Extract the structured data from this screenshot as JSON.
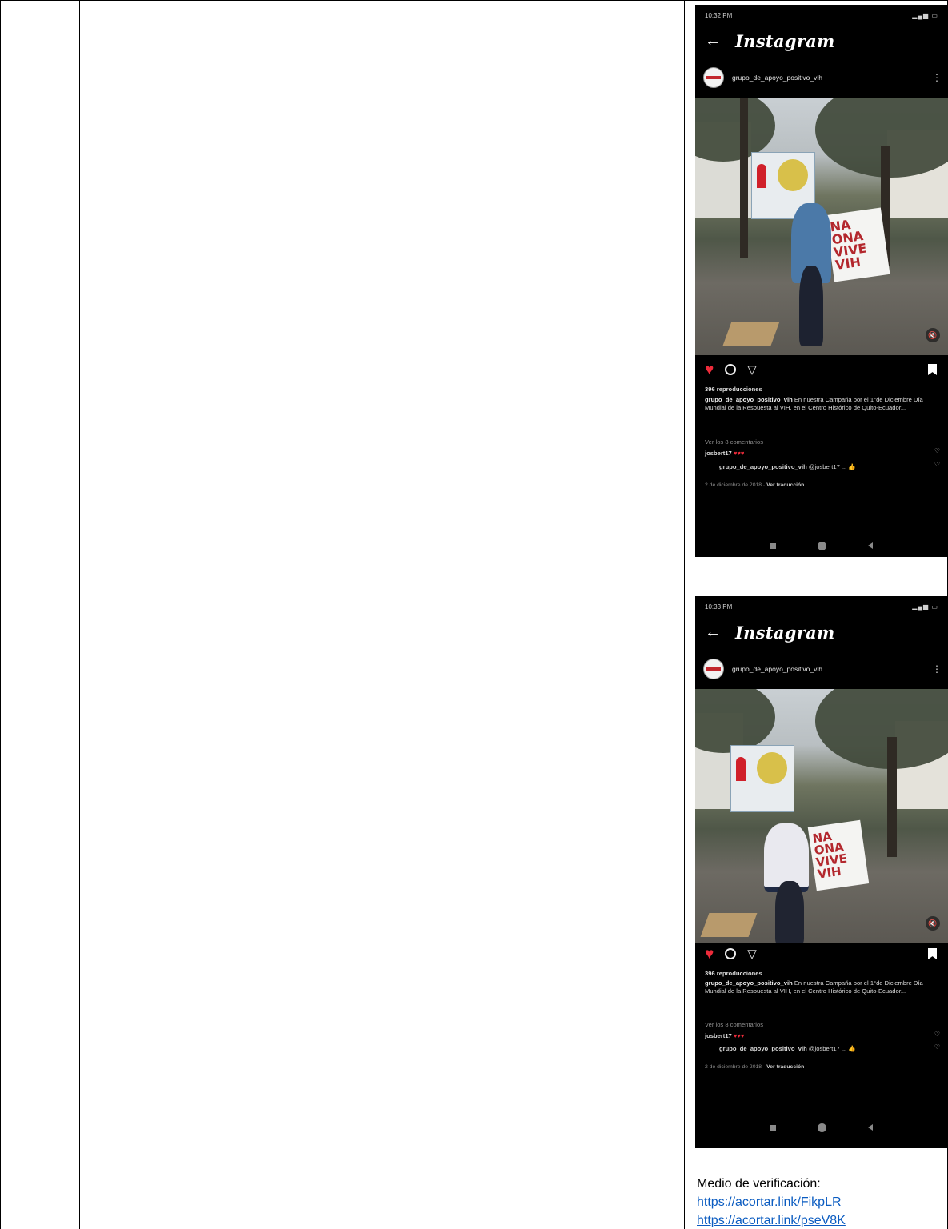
{
  "posts": [
    {
      "status_time": "10:32 PM",
      "status_right": "4G",
      "app_title": "Instagram",
      "username": "grupo_de_apoyo_positivo_vih",
      "views": "396 reproducciones",
      "caption_user": "grupo_de_apoyo_positivo_vih",
      "caption_text": "En nuestra Campaña por el 1°de Diciembre Día Mundial de la Respuesta al VIH, en el Centro Histórico de Quito-Ecuador...",
      "view_comments": "Ver los 8 comentarios",
      "comment_user": "josbert17",
      "comment_emojis": "♥♥♥",
      "reply_user": "grupo_de_apoyo_positivo_vih",
      "reply_text": "@josbert17 ...",
      "reply_emoji": "👍",
      "date": "2 de diciembre de 2018",
      "translate": "Ver traducción",
      "banner_text": "NA\nONA\nVIVE\nVIH"
    },
    {
      "status_time": "10:33 PM",
      "status_right": "4G",
      "app_title": "Instagram",
      "username": "grupo_de_apoyo_positivo_vih",
      "views": "396 reproducciones",
      "caption_user": "grupo_de_apoyo_positivo_vih",
      "caption_text": "En nuestra Campaña por el 1°de Diciembre Día Mundial de la Respuesta al VIH, en el Centro Histórico de Quito-Ecuador...",
      "view_comments": "Ver los 8 comentarios",
      "comment_user": "josbert17",
      "comment_emojis": "♥♥♥",
      "reply_user": "grupo_de_apoyo_positivo_vih",
      "reply_text": "@josbert17 ...",
      "reply_emoji": "👍",
      "date": "2 de diciembre de 2018",
      "translate": "Ver traducción",
      "banner_text": "NA\nONA\nVIVE\nVIH"
    }
  ],
  "verification": {
    "label": "Medio de verificación:",
    "links": [
      "https://acortar.link/FikpLR",
      "https://acortar.link/pseV8K"
    ]
  },
  "colors": {
    "link": "#0b5cc1",
    "heart": "#ed2b3a",
    "phone_bg": "#000000"
  }
}
